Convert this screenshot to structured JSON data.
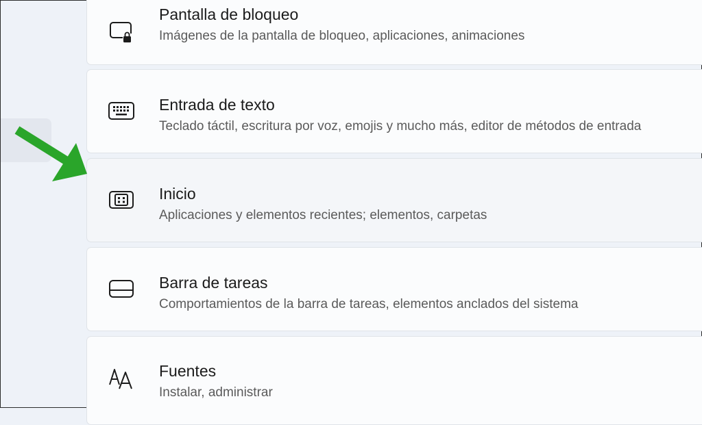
{
  "settings": {
    "items": [
      {
        "title": "Pantalla de bloqueo",
        "description": "Imágenes de la pantalla de bloqueo, aplicaciones, animaciones",
        "icon": "lock-screen-icon"
      },
      {
        "title": "Entrada de texto",
        "description": "Teclado táctil, escritura por voz, emojis y mucho más, editor de métodos de entrada",
        "icon": "keyboard-icon"
      },
      {
        "title": "Inicio",
        "description": "Aplicaciones y elementos recientes; elementos, carpetas",
        "icon": "start-menu-icon"
      },
      {
        "title": "Barra de tareas",
        "description": "Comportamientos de la barra de tareas, elementos anclados del sistema",
        "icon": "taskbar-icon"
      },
      {
        "title": "Fuentes",
        "description": "Instalar, administrar",
        "icon": "fonts-icon"
      }
    ]
  },
  "annotation": {
    "arrow_color": "#2aa52a",
    "arrow_icon": "arrow-icon"
  }
}
